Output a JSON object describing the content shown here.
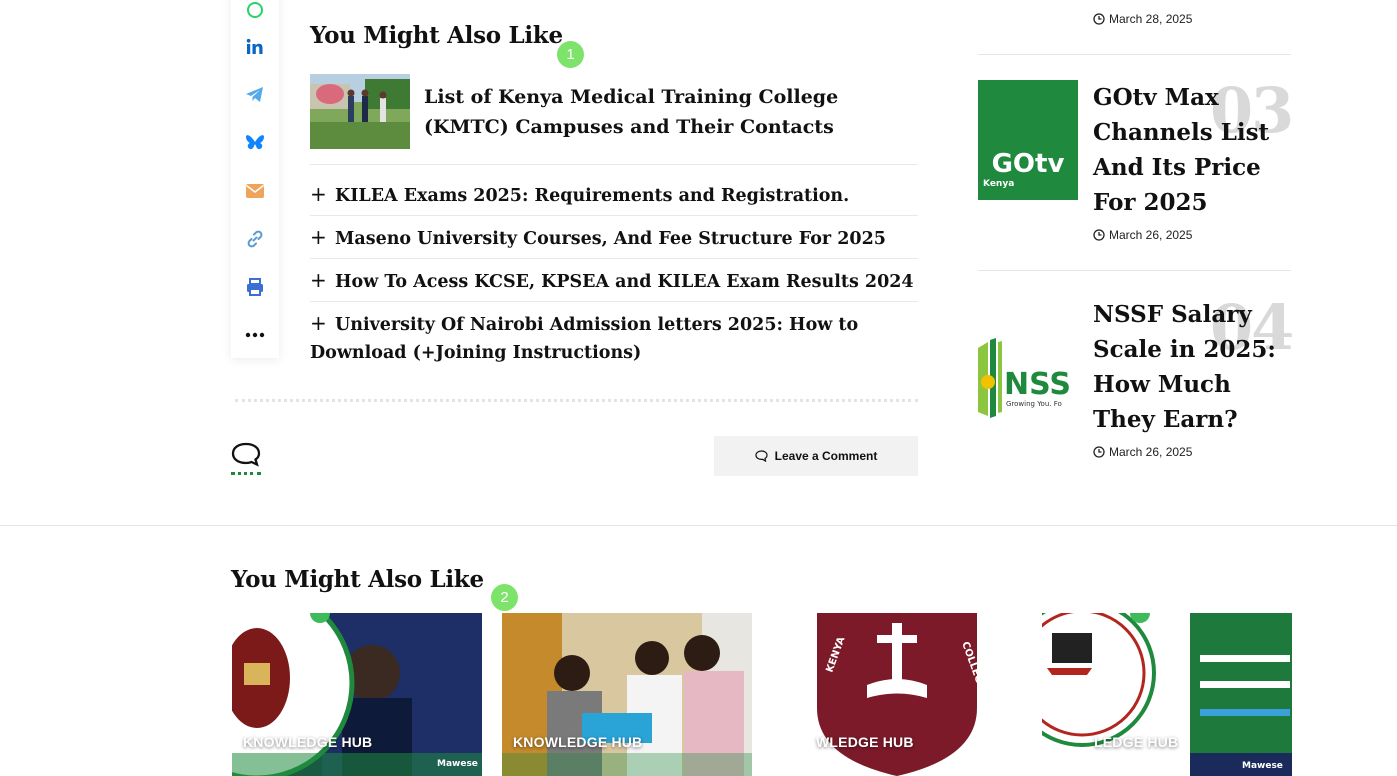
{
  "share": {
    "items": [
      {
        "name": "whatsapp"
      },
      {
        "name": "linkedin"
      },
      {
        "name": "telegram"
      },
      {
        "name": "bluesky"
      },
      {
        "name": "email"
      },
      {
        "name": "copy-link"
      },
      {
        "name": "print"
      },
      {
        "name": "more"
      }
    ],
    "colors": {
      "linkedin": "#0a66c2",
      "telegram": "#54a9eb",
      "bluesky": "#1185fe",
      "email": "#f0a45b",
      "link": "#5a9bd5",
      "print": "#3b6fd1",
      "whatsapp": "#25d366"
    }
  },
  "main": {
    "related_heading": "You Might Also Like",
    "badge1": "1",
    "featured": {
      "title": "List of Kenya Medical Training College (KMTC) Campuses and Their Contacts"
    },
    "related": [
      {
        "title": "KILEA Exams 2025: Requirements and Registration."
      },
      {
        "title": "Maseno University Courses, And Fee Structure For 2025"
      },
      {
        "title": "How To Acess KCSE, KPSEA and KILEA Exam Results 2024"
      },
      {
        "title": "University Of Nairobi Admission letters 2025: How to Download (+Joining Instructions)"
      }
    ],
    "plus_symbol": "+",
    "leave_comment": "Leave a Comment"
  },
  "sidebar": {
    "top_date": "March 28, 2025",
    "items": [
      {
        "num": "03",
        "title": "GOtv Max Channels List And Its Price For 2025",
        "date": "March 26, 2025",
        "thumb_text": "GOtv",
        "thumb_sub": "Kenya"
      },
      {
        "num": "04",
        "title": "NSSF Salary Scale in 2025: How Much They Earn?",
        "date": "March 26, 2025",
        "thumb_text": "NSS",
        "thumb_sub": "Growing You. Fo"
      }
    ]
  },
  "bottom": {
    "heading": "You Might Also Like",
    "badge2": "2",
    "cards": [
      {
        "category": "KNOWLEDGE HUB"
      },
      {
        "category": "KNOWLEDGE HUB"
      },
      {
        "category": "WLEDGE HUB"
      },
      {
        "category": "LEDGE HUB"
      }
    ]
  }
}
